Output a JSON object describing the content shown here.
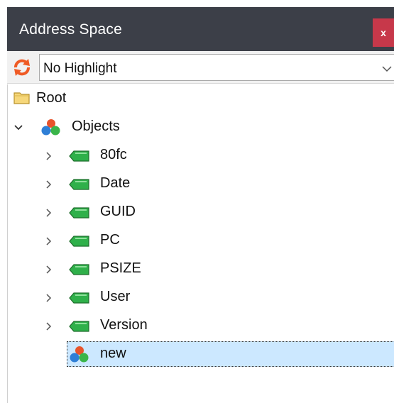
{
  "panel": {
    "title": "Address Space",
    "close_label": "x"
  },
  "toolbar": {
    "refresh_icon": "refresh-icon",
    "highlight_selected": "No Highlight"
  },
  "tree": {
    "root_label": "Root",
    "objects_label": "Objects",
    "children": [
      {
        "label": "80fc",
        "icon": "tag-icon"
      },
      {
        "label": "Date",
        "icon": "tag-icon"
      },
      {
        "label": "GUID",
        "icon": "tag-icon"
      },
      {
        "label": "PC",
        "icon": "tag-icon"
      },
      {
        "label": "PSIZE",
        "icon": "tag-icon"
      },
      {
        "label": "User",
        "icon": "tag-icon"
      },
      {
        "label": "Version",
        "icon": "tag-icon"
      }
    ],
    "new_label": "new",
    "selected": "new"
  },
  "colors": {
    "titlebar": "#3c3f48",
    "close": "#c7384a",
    "selection": "#cce8ff",
    "tag_green": "#2fb04a"
  }
}
